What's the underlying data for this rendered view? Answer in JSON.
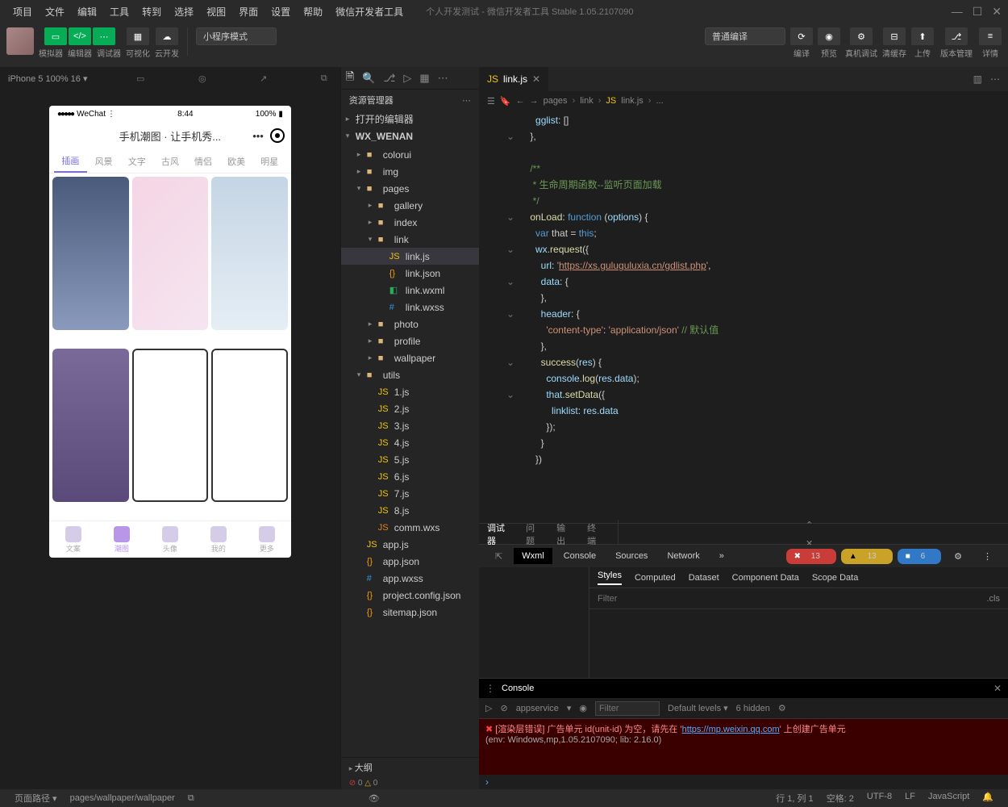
{
  "titlebar": {
    "menus": [
      "项目",
      "文件",
      "编辑",
      "工具",
      "转到",
      "选择",
      "视图",
      "界面",
      "设置",
      "帮助",
      "微信开发者工具"
    ],
    "title": "个人开发测试 - 微信开发者工具 Stable 1.05.2107090"
  },
  "toolbar": {
    "mode_labels": [
      "模拟器",
      "编辑器",
      "调试器"
    ],
    "visualize": "可视化",
    "cloud": "云开发",
    "mode_select": "小程序模式",
    "compile_select": "普通编译",
    "actions": {
      "compile": "编译",
      "preview": "预览",
      "remote": "真机调试",
      "clear": "清缓存"
    },
    "right": {
      "upload": "上传",
      "version": "版本管理",
      "detail": "详情"
    }
  },
  "sim": {
    "device": "iPhone 5 100% 16 ▾",
    "phone": {
      "carrier": "WeChat",
      "time": "8:44",
      "battery": "100%",
      "title": "手机潮图 · 让手机秀...",
      "tabs": [
        "插画",
        "风景",
        "文字",
        "古风",
        "情侣",
        "欧美",
        "明星"
      ],
      "nav": [
        "文案",
        "潮图",
        "头像",
        "我的",
        "更多"
      ]
    }
  },
  "explorer": {
    "title": "资源管理器",
    "sections": {
      "open_editors": "打开的编辑器",
      "project": "WX_WENAN",
      "outline": "大纲"
    },
    "tree": [
      {
        "n": "colorui",
        "t": "folder",
        "d": 1
      },
      {
        "n": "img",
        "t": "folder",
        "d": 1,
        "ico": "img"
      },
      {
        "n": "pages",
        "t": "folder",
        "d": 1,
        "open": true,
        "children": [
          {
            "n": "gallery",
            "t": "folder",
            "d": 2
          },
          {
            "n": "index",
            "t": "folder",
            "d": 2
          },
          {
            "n": "link",
            "t": "folder",
            "d": 2,
            "open": true,
            "children": [
              {
                "n": "link.js",
                "t": "js",
                "d": 3,
                "sel": true
              },
              {
                "n": "link.json",
                "t": "json",
                "d": 3
              },
              {
                "n": "link.wxml",
                "t": "wxml",
                "d": 3
              },
              {
                "n": "link.wxss",
                "t": "wxss",
                "d": 3
              }
            ]
          },
          {
            "n": "photo",
            "t": "folder",
            "d": 2
          },
          {
            "n": "profile",
            "t": "folder",
            "d": 2
          },
          {
            "n": "wallpaper",
            "t": "folder",
            "d": 2
          }
        ]
      },
      {
        "n": "utils",
        "t": "folder",
        "d": 1,
        "open": true,
        "ico": "img",
        "children": [
          {
            "n": "1.js",
            "t": "js",
            "d": 2
          },
          {
            "n": "2.js",
            "t": "js",
            "d": 2
          },
          {
            "n": "3.js",
            "t": "js",
            "d": 2
          },
          {
            "n": "4.js",
            "t": "js",
            "d": 2
          },
          {
            "n": "5.js",
            "t": "js",
            "d": 2
          },
          {
            "n": "6.js",
            "t": "js",
            "d": 2
          },
          {
            "n": "7.js",
            "t": "js",
            "d": 2
          },
          {
            "n": "8.js",
            "t": "js",
            "d": 2
          },
          {
            "n": "comm.wxs",
            "t": "wxs",
            "d": 2
          }
        ]
      },
      {
        "n": "app.js",
        "t": "js",
        "d": 1
      },
      {
        "n": "app.json",
        "t": "json",
        "d": 1
      },
      {
        "n": "app.wxss",
        "t": "wxss",
        "d": 1
      },
      {
        "n": "project.config.json",
        "t": "json",
        "d": 1
      },
      {
        "n": "sitemap.json",
        "t": "json",
        "d": 1
      }
    ]
  },
  "editor": {
    "tab": "link.js",
    "crumbs": [
      "pages",
      "link",
      "link.js",
      "..."
    ],
    "code_lines": [
      {
        "indent": 3,
        "tokens": [
          {
            "c": "prop",
            "t": "gglist"
          },
          {
            "c": "pun",
            "t": ": []"
          }
        ]
      },
      {
        "indent": 2,
        "tokens": [
          {
            "c": "pun",
            "t": "},"
          }
        ]
      },
      {
        "indent": 0,
        "tokens": []
      },
      {
        "indent": 2,
        "tokens": [
          {
            "c": "com",
            "t": "/**"
          }
        ]
      },
      {
        "indent": 2,
        "tokens": [
          {
            "c": "com",
            "t": " * 生命周期函数--监听页面加载"
          }
        ]
      },
      {
        "indent": 2,
        "tokens": [
          {
            "c": "com",
            "t": " */"
          }
        ]
      },
      {
        "indent": 2,
        "tokens": [
          {
            "c": "fn",
            "t": "onLoad"
          },
          {
            "c": "pun",
            "t": ": "
          },
          {
            "c": "key",
            "t": "function"
          },
          {
            "c": "pun",
            "t": " ("
          },
          {
            "c": "par",
            "t": "options"
          },
          {
            "c": "pun",
            "t": ") {"
          }
        ]
      },
      {
        "indent": 3,
        "tokens": [
          {
            "c": "key",
            "t": "var"
          },
          {
            "c": "pun",
            "t": " that = "
          },
          {
            "c": "this",
            "t": "this"
          },
          {
            "c": "pun",
            "t": ";"
          }
        ]
      },
      {
        "indent": 3,
        "tokens": [
          {
            "c": "par",
            "t": "wx"
          },
          {
            "c": "pun",
            "t": "."
          },
          {
            "c": "fn",
            "t": "request"
          },
          {
            "c": "pun",
            "t": "({"
          }
        ]
      },
      {
        "indent": 4,
        "tokens": [
          {
            "c": "prop",
            "t": "url"
          },
          {
            "c": "pun",
            "t": ": "
          },
          {
            "c": "str",
            "t": "'"
          },
          {
            "c": "url",
            "t": "https://xs.guluguluxia.cn/gdlist.php"
          },
          {
            "c": "str",
            "t": "'"
          },
          {
            "c": "pun",
            "t": ","
          }
        ]
      },
      {
        "indent": 4,
        "tokens": [
          {
            "c": "prop",
            "t": "data"
          },
          {
            "c": "pun",
            "t": ": {"
          }
        ]
      },
      {
        "indent": 4,
        "tokens": [
          {
            "c": "pun",
            "t": "},"
          }
        ]
      },
      {
        "indent": 4,
        "tokens": [
          {
            "c": "prop",
            "t": "header"
          },
          {
            "c": "pun",
            "t": ": {"
          }
        ]
      },
      {
        "indent": 5,
        "tokens": [
          {
            "c": "str",
            "t": "'content-type'"
          },
          {
            "c": "pun",
            "t": ": "
          },
          {
            "c": "str",
            "t": "'application/json'"
          },
          {
            "c": "pun",
            "t": " "
          },
          {
            "c": "com",
            "t": "// 默认值"
          }
        ]
      },
      {
        "indent": 4,
        "tokens": [
          {
            "c": "pun",
            "t": "},"
          }
        ]
      },
      {
        "indent": 4,
        "tokens": [
          {
            "c": "fn",
            "t": "success"
          },
          {
            "c": "pun",
            "t": "("
          },
          {
            "c": "par",
            "t": "res"
          },
          {
            "c": "pun",
            "t": ") {"
          }
        ]
      },
      {
        "indent": 5,
        "tokens": [
          {
            "c": "par",
            "t": "console"
          },
          {
            "c": "pun",
            "t": "."
          },
          {
            "c": "fn",
            "t": "log"
          },
          {
            "c": "pun",
            "t": "("
          },
          {
            "c": "par",
            "t": "res"
          },
          {
            "c": "pun",
            "t": "."
          },
          {
            "c": "par",
            "t": "data"
          },
          {
            "c": "pun",
            "t": ");"
          }
        ]
      },
      {
        "indent": 5,
        "tokens": [
          {
            "c": "par",
            "t": "that"
          },
          {
            "c": "pun",
            "t": "."
          },
          {
            "c": "fn",
            "t": "setData"
          },
          {
            "c": "pun",
            "t": "({"
          }
        ]
      },
      {
        "indent": 6,
        "tokens": [
          {
            "c": "prop",
            "t": "linklist"
          },
          {
            "c": "pun",
            "t": ": "
          },
          {
            "c": "par",
            "t": "res"
          },
          {
            "c": "pun",
            "t": "."
          },
          {
            "c": "par",
            "t": "data"
          }
        ]
      },
      {
        "indent": 5,
        "tokens": [
          {
            "c": "pun",
            "t": "});"
          }
        ]
      },
      {
        "indent": 4,
        "tokens": [
          {
            "c": "pun",
            "t": "}"
          }
        ]
      },
      {
        "indent": 3,
        "tokens": [
          {
            "c": "pun",
            "t": "})"
          }
        ]
      }
    ]
  },
  "devtools": {
    "tabs": [
      "调试器",
      "问题",
      "输出",
      "终端"
    ],
    "subtabs": [
      "Wxml",
      "Console",
      "Sources",
      "Network"
    ],
    "badges": {
      "err": "13",
      "warn": "13",
      "info": "6"
    },
    "styles_tabs": [
      "Styles",
      "Computed",
      "Dataset",
      "Component Data",
      "Scope Data"
    ],
    "filter_placeholder": "Filter",
    "cls": ".cls",
    "console": {
      "title": "Console",
      "context": "appservice",
      "filter_placeholder": "Filter",
      "levels": "Default levels ▾",
      "hidden": "6 hidden",
      "error_line1": "[渲染层错误] 广告单元 id(unit-id) 为空，请先在 '",
      "error_url": "https://mp.weixin.qq.com",
      "error_line1b": "' 上创建广告单元",
      "error_env": "(env: Windows,mp,1.05.2107090; lib: 2.16.0)"
    }
  },
  "statusbar": {
    "path_label": "页面路径 ▾",
    "path": "pages/wallpaper/wallpaper",
    "counts": {
      "err": "0",
      "warn": "0"
    },
    "pos": "行 1, 列 1",
    "spaces": "空格: 2",
    "enc": "UTF-8",
    "eol": "LF",
    "lang": "JavaScript"
  }
}
